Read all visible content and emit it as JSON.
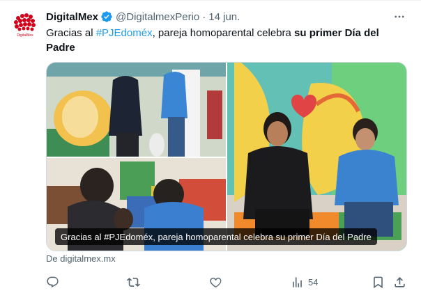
{
  "tweet": {
    "author": {
      "name": "DigitalMex",
      "handle": "@DigitalmexPerio",
      "separator": "·",
      "date": "14 jun.",
      "avatar_text": "DigitalMex"
    },
    "text": {
      "part1": "Gracias al ",
      "hashtag": "#PJEdoméx",
      "part2": ", pareja homoparental celebra ",
      "bold": "su primer Día del Padre"
    },
    "card": {
      "caption": "Gracias al #PJEdoméx, pareja homoparental celebra su primer Día del Padre"
    },
    "source": "De digitalmex.mx",
    "stats": {
      "views": "54"
    },
    "colors": {
      "accent": "#1d9bf0",
      "text": "#0f1419",
      "secondary": "#536471",
      "verified": "#1d9bf0"
    },
    "icons": [
      "verified-badge-icon",
      "more-icon",
      "reply-icon",
      "retweet-icon",
      "like-icon",
      "views-icon",
      "bookmark-icon",
      "share-icon"
    ]
  }
}
